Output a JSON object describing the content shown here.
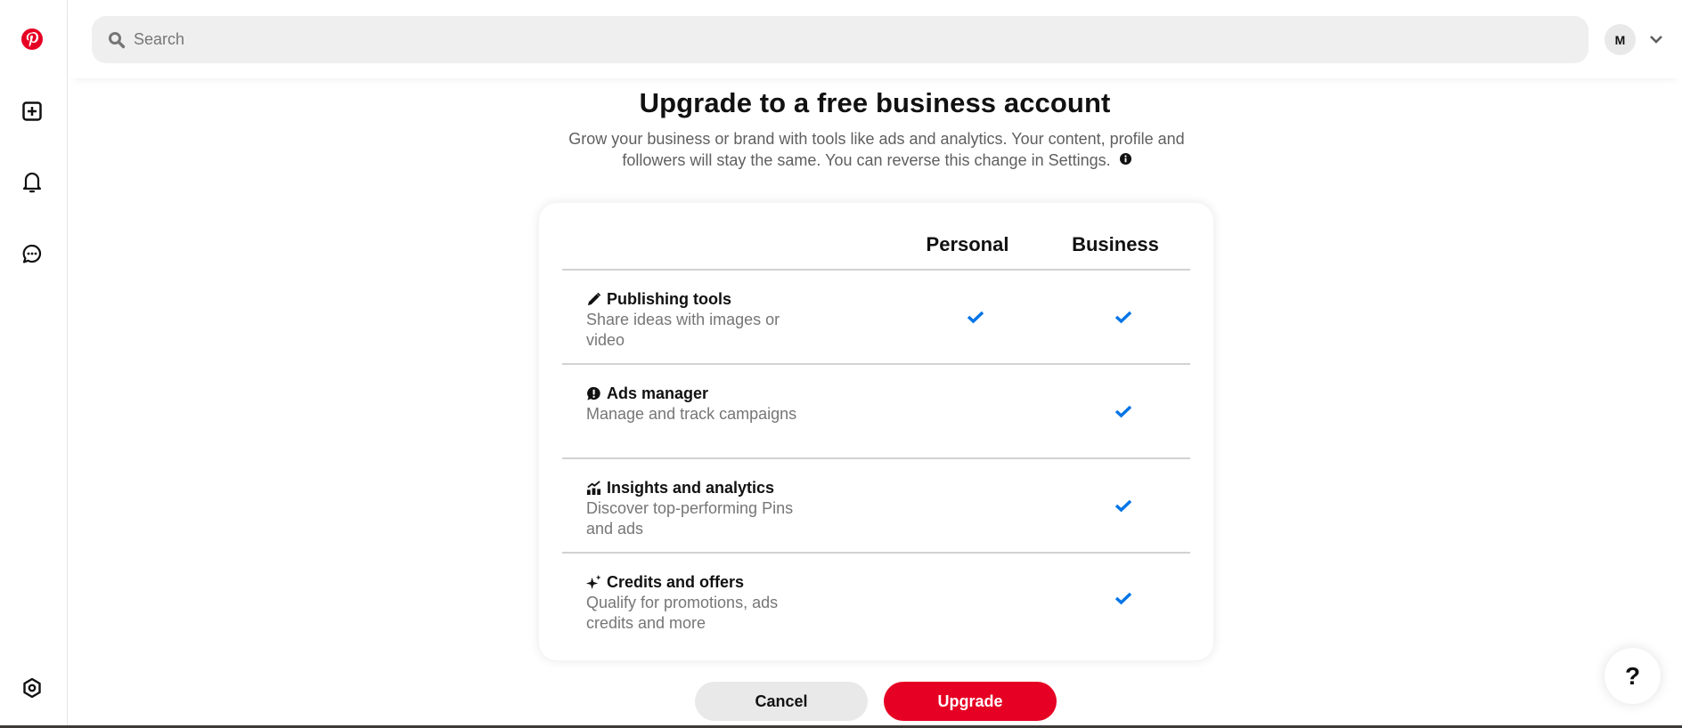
{
  "sidebar": {
    "items": [
      {
        "name": "pinterest-logo",
        "label": "Pinterest home"
      },
      {
        "name": "create",
        "label": "Create"
      },
      {
        "name": "notifications",
        "label": "Notifications"
      },
      {
        "name": "messages",
        "label": "Messages"
      },
      {
        "name": "settings",
        "label": "Settings"
      }
    ]
  },
  "header": {
    "search_placeholder": "Search",
    "avatar_initial": "M"
  },
  "main": {
    "title": "Upgrade to a free business account",
    "subtitle": "Grow your business or brand with tools like ads and analytics. Your content, profile and followers will stay the same. You can reverse this change in Settings.",
    "columns": [
      "Personal",
      "Business"
    ],
    "features": [
      {
        "icon": "pencil-icon",
        "title": "Publishing tools",
        "description": "Share ideas with images or video",
        "personal": true,
        "business": true
      },
      {
        "icon": "ads-manager-icon",
        "title": "Ads manager",
        "description": "Manage and track campaigns",
        "personal": false,
        "business": true
      },
      {
        "icon": "analytics-icon",
        "title": "Insights and analytics",
        "description": "Discover top-performing Pins and ads",
        "personal": false,
        "business": true
      },
      {
        "icon": "sparkle-icon",
        "title": "Credits and offers",
        "description": "Qualify for promotions, ads credits and more",
        "personal": false,
        "business": true
      }
    ],
    "cancel_label": "Cancel",
    "upgrade_label": "Upgrade"
  },
  "help_label": "?",
  "colors": {
    "brand": "#e60023",
    "check": "#0074e8"
  }
}
